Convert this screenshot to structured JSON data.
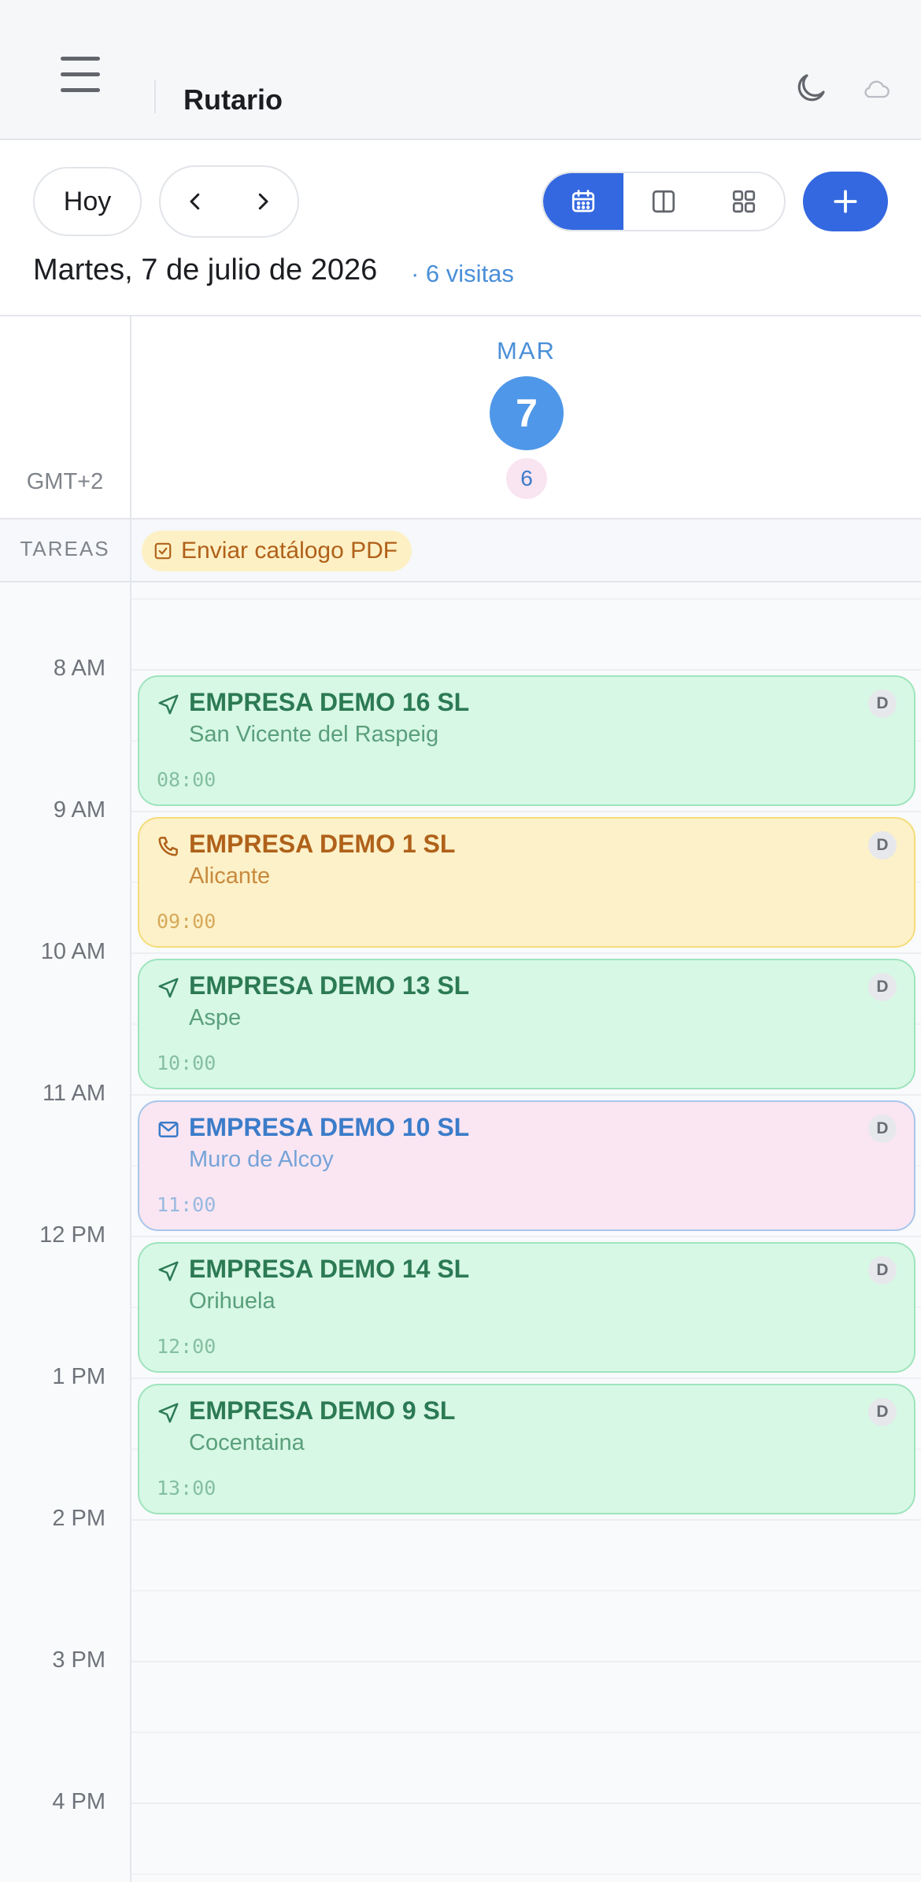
{
  "app": {
    "title": "Rutario"
  },
  "toolbar": {
    "today_label": "Hoy",
    "date_label": "Martes, 7 de julio de 2026",
    "visit_count": "· 6 visitas"
  },
  "day": {
    "weekday": "MAR",
    "number": "7",
    "badge": "6",
    "timezone": "GMT+2"
  },
  "tasks": {
    "label": "TAREAS",
    "items": [
      {
        "label": "Enviar catálogo PDF"
      }
    ]
  },
  "hours": [
    "8 AM",
    "9 AM",
    "10 AM",
    "11 AM",
    "12 PM",
    "1 PM",
    "2 PM",
    "3 PM",
    "4 PM"
  ],
  "events": [
    {
      "title": "EMPRESA DEMO 16 SL",
      "location": "San Vicente del Raspeig",
      "time": "08:00",
      "badge": "D",
      "kind": "visit"
    },
    {
      "title": "EMPRESA DEMO 1 SL",
      "location": "Alicante",
      "time": "09:00",
      "badge": "D",
      "kind": "call"
    },
    {
      "title": "EMPRESA DEMO 13 SL",
      "location": "Aspe",
      "time": "10:00",
      "badge": "D",
      "kind": "visit"
    },
    {
      "title": "EMPRESA DEMO 10 SL",
      "location": "Muro de Alcoy",
      "time": "11:00",
      "badge": "D",
      "kind": "email"
    },
    {
      "title": "EMPRESA DEMO 14 SL",
      "location": "Orihuela",
      "time": "12:00",
      "badge": "D",
      "kind": "visit"
    },
    {
      "title": "EMPRESA DEMO 9 SL",
      "location": "Cocentaina",
      "time": "13:00",
      "badge": "D",
      "kind": "visit"
    }
  ],
  "colors": {
    "accent": "#3468e0",
    "today": "#4f97e8",
    "visit": "#d7f8e5",
    "call": "#fcf1c8",
    "email": "#f9e6f2"
  }
}
